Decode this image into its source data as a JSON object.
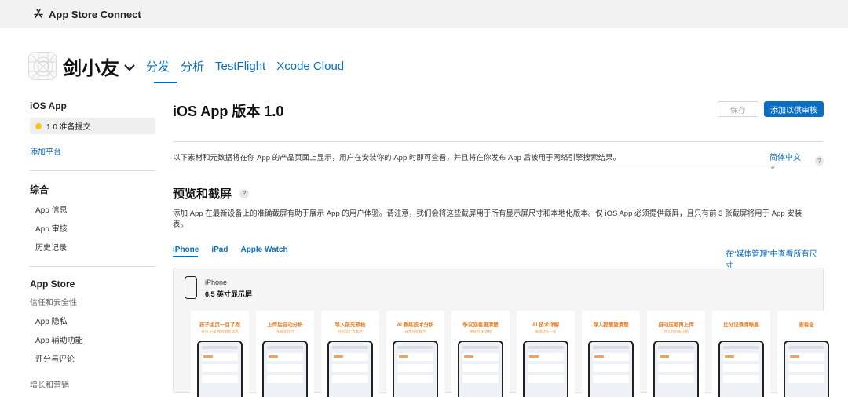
{
  "topbar": {
    "brand": "App Store Connect",
    "logo_icon": "app-store-icon"
  },
  "app": {
    "name": "剑小友",
    "icon": "app-icon"
  },
  "nav": {
    "tabs": [
      "分发",
      "分析",
      "TestFlight",
      "Xcode Cloud"
    ],
    "active": "分发"
  },
  "sidebar": {
    "platform_header": "iOS App",
    "version_label": "1.0 准备提交",
    "version_status_color": "#f5c518",
    "add_platform": "添加平台",
    "general_header": "综合",
    "general_items": [
      "App 信息",
      "App 审核",
      "历史记录"
    ],
    "store_header": "App Store",
    "trust_sub": "信任和安全性",
    "trust_items": [
      "App 隐私",
      "App 辅助功能",
      "评分与评论"
    ],
    "growth_sub": "增长和营销"
  },
  "main": {
    "title": "iOS App 版本 1.0",
    "save_label": "保存",
    "submit_label": "添加以供审核",
    "description": "以下素材和元数据将在你 App 的产品页面上显示，用户在安装你的 App 时即可查看，并且将在你发布 App 后被用于网络引擎搜索结果。",
    "language": "简体中文 ⌄",
    "help": "?",
    "section_title": "预览和截屏",
    "section_desc": "添加 App 在最新设备上的准确截屏有助于展示 App 的用户体验。请注意，我们会将这些截屏用于所有显示屏尺寸和本地化版本。仅 iOS App 必须提供截屏，且只有前 3 张截屏将用于 App 安装表。",
    "device_tabs": [
      "iPhone",
      "iPad",
      "Apple Watch"
    ],
    "active_device": "iPhone",
    "media_link": "在“媒体管理”中查看所有尺寸",
    "device_name": "iPhone",
    "device_size": "6.5 英寸显示屏",
    "accent_color": "#0a6fc2",
    "screenshots": [
      {
        "caption": "孩子主页一目了然",
        "sub": "待回 记录 视频解析动态"
      },
      {
        "caption": "上传后自动分析",
        "sub": "多角度分析"
      },
      {
        "caption": "导入前先预检",
        "sub": "分析前上传素材"
      },
      {
        "caption": "AI 教练技术分析",
        "sub": "技术分析报告"
      },
      {
        "caption": "争议回看更清楚",
        "sub": "视频回放 逐帧"
      },
      {
        "caption": "AI 技术详解",
        "sub": "关键动作一览"
      },
      {
        "caption": "导入提醒更清楚",
        "sub": ""
      },
      {
        "caption": "自动压缩再上传",
        "sub": "导入后智能压缩"
      },
      {
        "caption": "比分记录清晰展",
        "sub": ""
      },
      {
        "caption": "查看全",
        "sub": ""
      }
    ]
  }
}
